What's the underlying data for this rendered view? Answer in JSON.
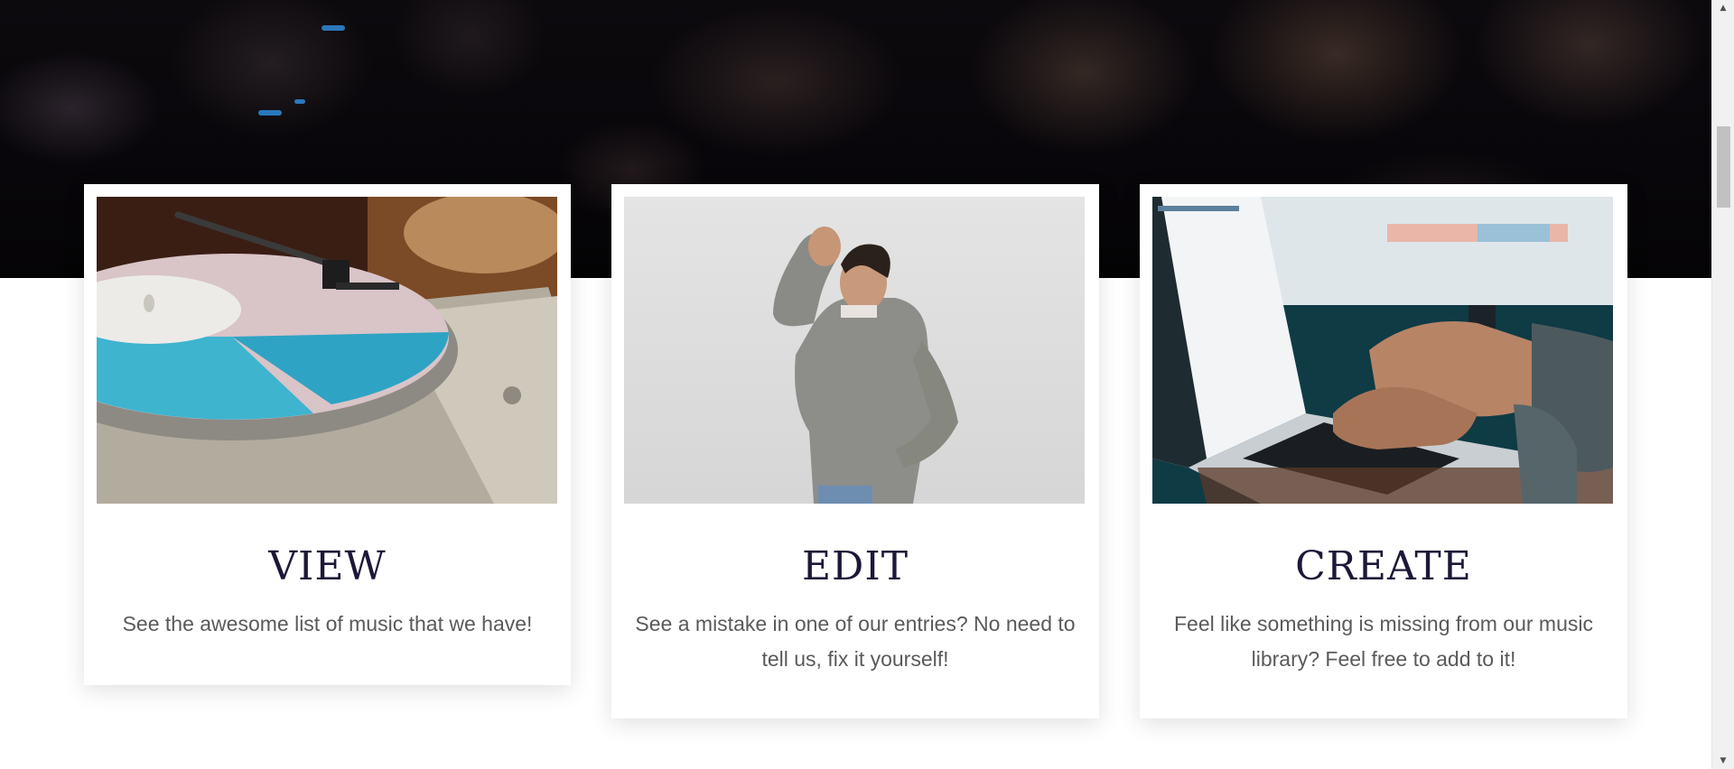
{
  "colors": {
    "title": "#1c1838",
    "body_text": "#5a5a5a",
    "hero_background": "#08060a",
    "accent_light": "#2f8bd9"
  },
  "hero": {
    "image": "dark-concert-crowd-image"
  },
  "cards": [
    {
      "image": "turntable-vinyl-record-image",
      "title": "VIEW",
      "text": "See the awesome list of music that we have!"
    },
    {
      "image": "man-facepalm-image",
      "title": "EDIT",
      "text": "See a mistake in one of our entries? No need to tell us, fix it yourself!"
    },
    {
      "image": "hands-typing-laptop-image",
      "title": "CREATE",
      "text": "Feel like something is missing from our music library? Feel free to add to it!"
    }
  ],
  "scrollbar": {
    "up_icon": "arrow-up-icon",
    "down_icon": "arrow-down-icon"
  }
}
